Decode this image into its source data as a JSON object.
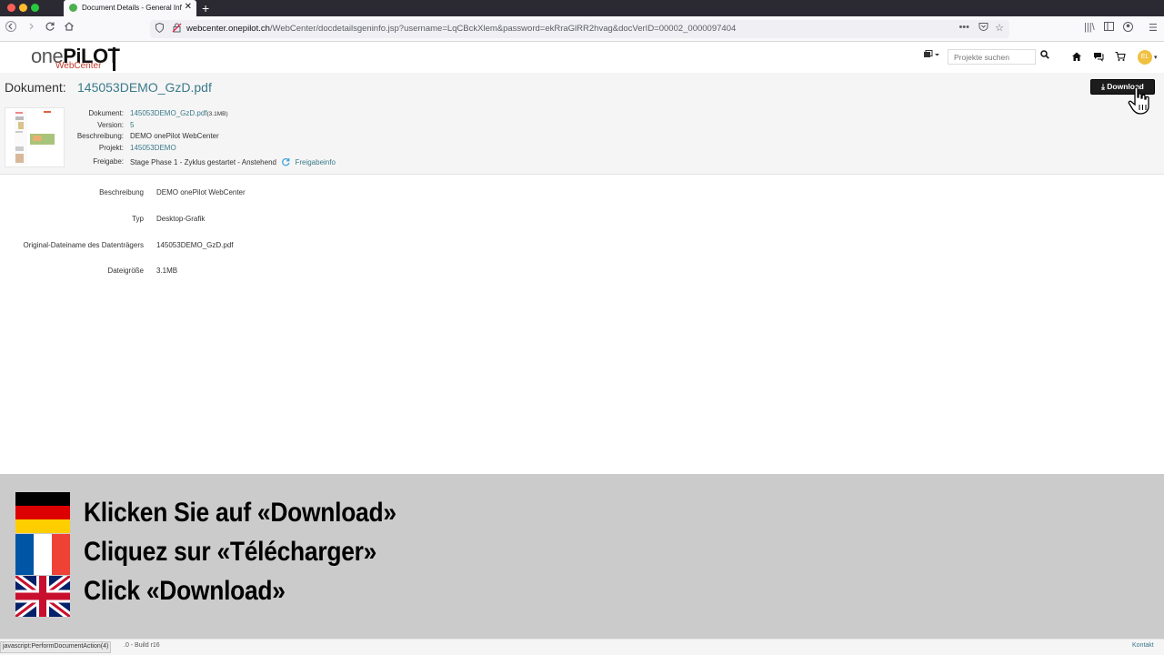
{
  "browser": {
    "tab_title": "Document Details - General Info",
    "url_host": "webcenter.onepilot.ch",
    "url_path": "/WebCenter/docdetailsgeninfo.jsp?username=LqCBckXlem&password=ekRraGlRR2hvag&docVerID=00002_0000097404",
    "new_tab_symbol": "+",
    "close_symbol": "✕",
    "status_text": "javascript:PerformDocumentAction(4)"
  },
  "app": {
    "logo_one": "one",
    "logo_pilot": "PiLOT",
    "logo_sub": "WebCenter",
    "search_placeholder": "Projekte suchen",
    "avatar": "EL"
  },
  "document": {
    "label": "Dokument:",
    "name": "145053DEMO_GzD.pdf",
    "download_label": "Download",
    "meta": {
      "dokument_key": "Dokument:",
      "dokument_val": "145053DEMO_GzD.pdf",
      "dokument_size": "(3.1MB)",
      "version_key": "Version:",
      "version_val": "5",
      "beschreibung_key": "Beschreibung:",
      "beschreibung_val": "DEMO onePilot WebCenter",
      "projekt_key": "Projekt:",
      "projekt_val": "145053DEMO",
      "freigabe_key": "Freigabe:",
      "freigabe_val": "Stage Phase 1 - Zyklus gestartet - Anstehend",
      "freigabe_link": "Freigabeinfo"
    }
  },
  "info": {
    "beschreibung_key": "Beschreibung",
    "beschreibung_val": "DEMO onePilot WebCenter",
    "typ_key": "Typ",
    "typ_val": "Desktop-Grafik",
    "orig_key": "Original-Dateiname des Datenträgers",
    "orig_val": "145053DEMO_GzD.pdf",
    "size_key": "Dateigröße",
    "size_val": "3.1MB"
  },
  "instructions": {
    "de": "Klicken Sie auf «Download»",
    "fr": "Cliquez sur «Télécharger»",
    "en": "Click «Download»"
  },
  "footer": {
    "build": ".0 -  Build r16",
    "kontakt": "Kontakt"
  },
  "colors": {
    "accent": "#3a7a8a",
    "logo_red": "#c0392b",
    "overlay_bg": "#cbcbcb"
  }
}
